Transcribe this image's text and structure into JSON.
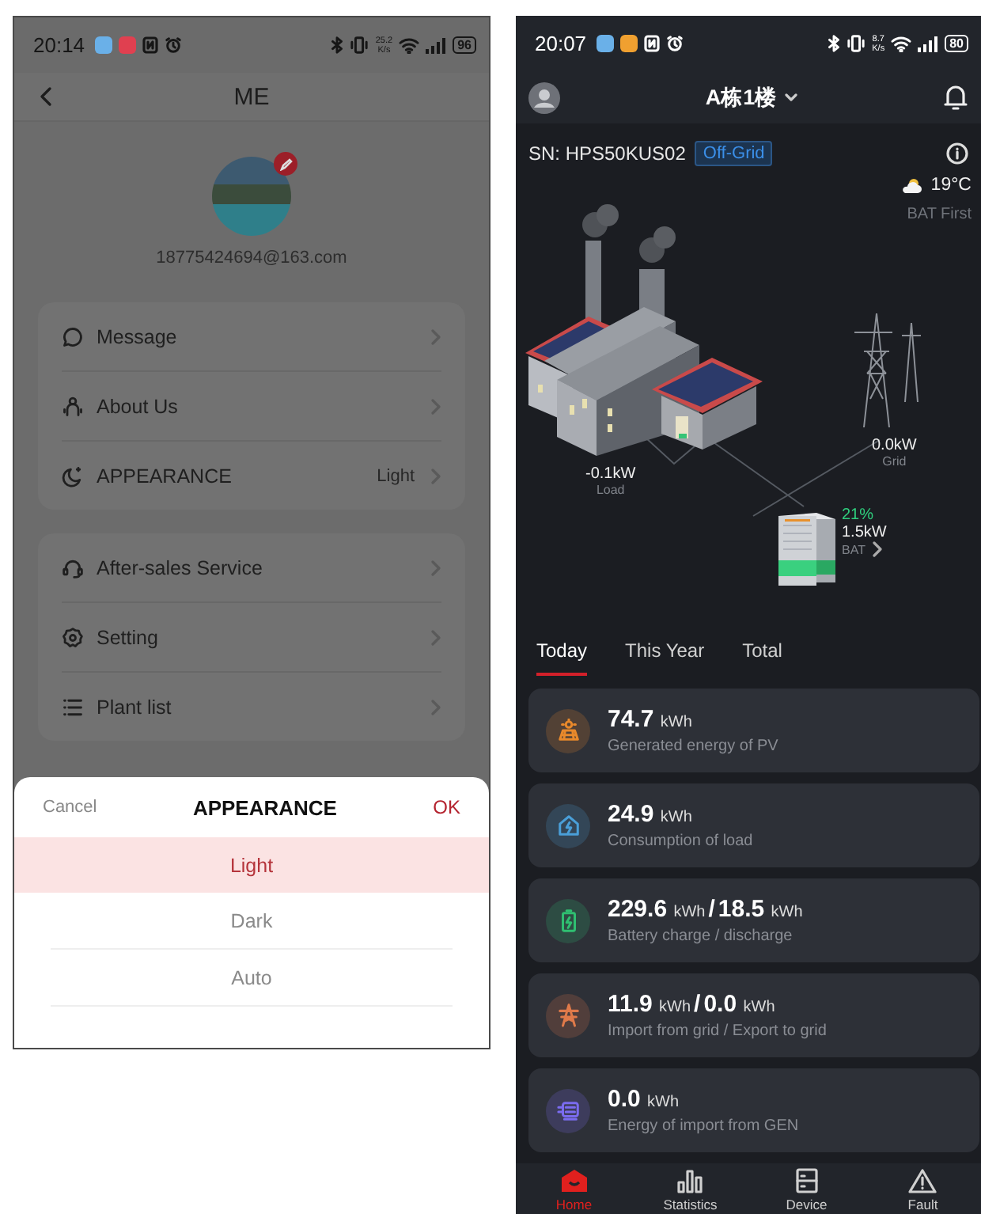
{
  "me_screen": {
    "status_bar": {
      "time": "20:14",
      "net_speed": [
        "25.2",
        "K/s"
      ],
      "battery": "96"
    },
    "header": {
      "title": "ME"
    },
    "profile": {
      "email": "18775424694@163.com"
    },
    "menu_groups": [
      [
        {
          "kind": "message",
          "label": "Message"
        },
        {
          "kind": "person",
          "label": "About Us"
        },
        {
          "kind": "moon",
          "label": "APPEARANCE",
          "value": "Light"
        }
      ],
      [
        {
          "kind": "headset",
          "label": "After-sales Service"
        },
        {
          "kind": "gear",
          "label": "Setting"
        },
        {
          "kind": "list",
          "label": "Plant list"
        }
      ]
    ],
    "appearance_sheet": {
      "cancel": "Cancel",
      "title": "APPEARANCE",
      "ok": "OK",
      "options": [
        {
          "label": "Light",
          "selected": true
        },
        {
          "label": "Dark",
          "selected": false
        },
        {
          "label": "Auto",
          "selected": false
        }
      ]
    }
  },
  "home_screen": {
    "status_bar": {
      "time": "20:07",
      "net_speed": [
        "8.7",
        "K/s"
      ],
      "battery": "80"
    },
    "header": {
      "title": "A栋1楼"
    },
    "device": {
      "sn": "SN: HPS50KUS02",
      "mode": "Off-Grid",
      "temperature": "19°C",
      "priority": "BAT First"
    },
    "flow": {
      "load": {
        "power": "-0.1kW",
        "label": "Load"
      },
      "grid": {
        "power": "0.0kW",
        "label": "Grid"
      },
      "battery": {
        "soc": "21%",
        "power": "1.5kW",
        "label": "BAT"
      }
    },
    "tabs": [
      {
        "label": "Today",
        "selected": true
      },
      {
        "label": "This Year",
        "selected": false
      },
      {
        "label": "Total",
        "selected": false
      }
    ],
    "energy_cards": [
      {
        "kind": "pv",
        "color": "#e8892b",
        "readings": [
          {
            "value": "74.7",
            "unit": "kWh"
          }
        ],
        "label": "Generated energy of PV"
      },
      {
        "kind": "load",
        "color": "#4a9fd8",
        "readings": [
          {
            "value": "24.9",
            "unit": "kWh"
          }
        ],
        "label": "Consumption of load"
      },
      {
        "kind": "battery",
        "color": "#2fbf71",
        "readings": [
          {
            "value": "229.6",
            "unit": "kWh"
          },
          {
            "value": "18.5",
            "unit": "kWh"
          }
        ],
        "separator": "/",
        "label": "Battery charge / discharge"
      },
      {
        "kind": "grid",
        "color": "#e07a4a",
        "readings": [
          {
            "value": "11.9",
            "unit": "kWh"
          },
          {
            "value": "0.0",
            "unit": "kWh"
          }
        ],
        "separator": "/",
        "label": "Import from grid / Export to grid"
      },
      {
        "kind": "gen",
        "color": "#7b6cf0",
        "readings": [
          {
            "value": "0.0",
            "unit": "kWh"
          }
        ],
        "label": "Energy of import from GEN"
      }
    ],
    "nav": [
      {
        "kind": "home",
        "label": "Home",
        "selected": true
      },
      {
        "kind": "stats",
        "label": "Statistics",
        "selected": false
      },
      {
        "kind": "device",
        "label": "Device",
        "selected": false
      },
      {
        "kind": "fault",
        "label": "Fault",
        "selected": false
      }
    ]
  }
}
